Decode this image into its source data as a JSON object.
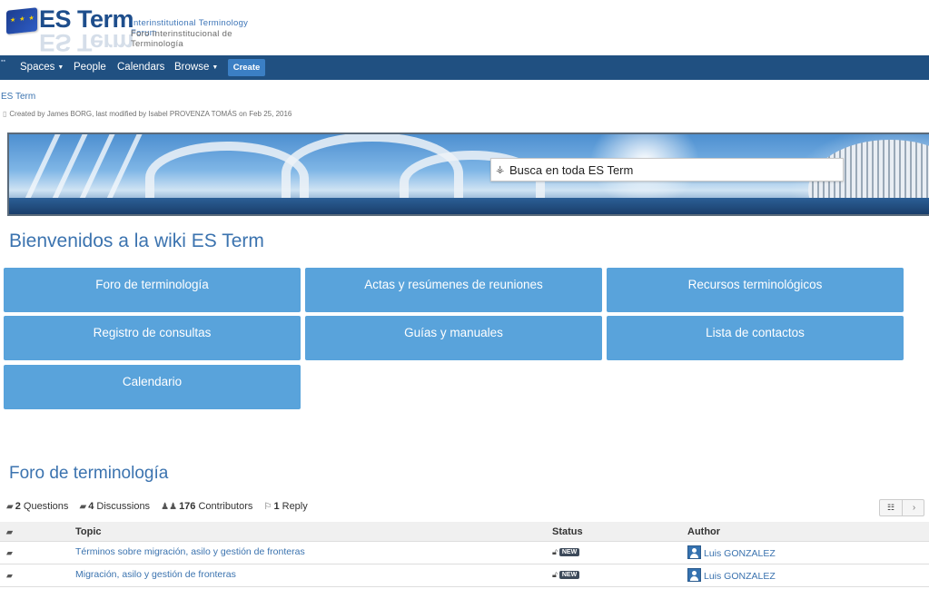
{
  "header": {
    "brand": "ES Term",
    "tagline_en": "Interinstitutional Terminology Forum",
    "tagline_es": "Foro Interinstitucional de Terminología"
  },
  "nav": {
    "spaces": "Spaces",
    "people": "People",
    "calendars": "Calendars",
    "browse": "Browse",
    "create": "Create"
  },
  "page": {
    "breadcrumb": "ES Term",
    "meta": "Created by James BORG, last modified by Isabel PROVENZA TOMÁS on Feb 25, 2016"
  },
  "banner": {
    "search_placeholder": "Busca en toda ES Term"
  },
  "welcome": "Bienvenidos a la wiki ES Term",
  "tiles": [
    "Foro de terminología",
    "Actas y resúmenes de reuniones",
    "Recursos terminológicos",
    "Registro de consultas",
    "Guías y manuales",
    "Lista de contactos",
    "Calendario"
  ],
  "forum": {
    "title": "Foro de terminología",
    "stats": {
      "questions_count": "2",
      "questions_label": "Questions",
      "discussions_count": "4",
      "discussions_label": "Discussions",
      "contributors_count": "176",
      "contributors_label": "Contributors",
      "replies_count": "1",
      "replies_label": "Reply"
    },
    "columns": {
      "topic": "Topic",
      "status": "Status",
      "author": "Author"
    },
    "rows": [
      {
        "topic": "Términos sobre migración, asilo y gestión de fronteras",
        "badge": "NEW",
        "author": "Luis GONZALEZ"
      },
      {
        "topic": "Migración, asilo y gestión de fronteras",
        "badge": "NEW",
        "author": "Luis GONZALEZ"
      }
    ]
  }
}
